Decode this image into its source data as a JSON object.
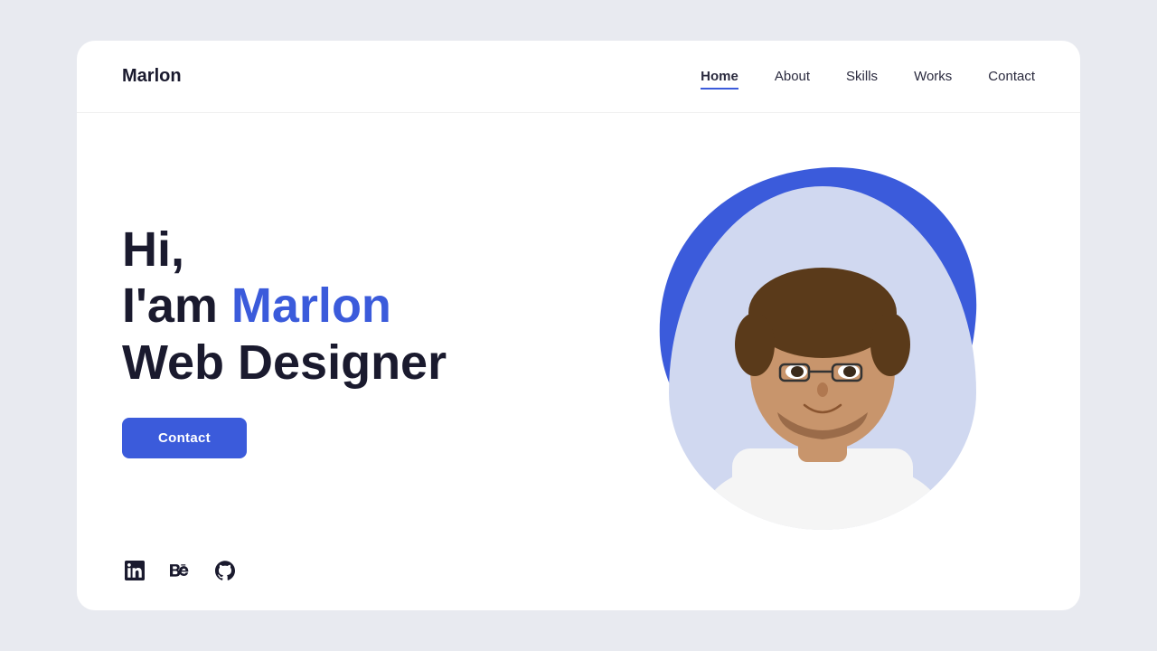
{
  "brand": "Marlon",
  "nav": {
    "items": [
      {
        "label": "Home",
        "active": true
      },
      {
        "label": "About",
        "active": false
      },
      {
        "label": "Skills",
        "active": false
      },
      {
        "label": "Works",
        "active": false
      },
      {
        "label": "Contact",
        "active": false
      }
    ]
  },
  "hero": {
    "greeting": "Hi,",
    "intro_prefix": "I'am ",
    "name": "Marlon",
    "title": "Web Designer",
    "contact_btn": "Contact"
  },
  "social": {
    "linkedin_label": "LinkedIn",
    "behance_label": "Behance",
    "github_label": "GitHub"
  },
  "colors": {
    "accent": "#3b5bdb",
    "dark": "#1a1a2e"
  }
}
